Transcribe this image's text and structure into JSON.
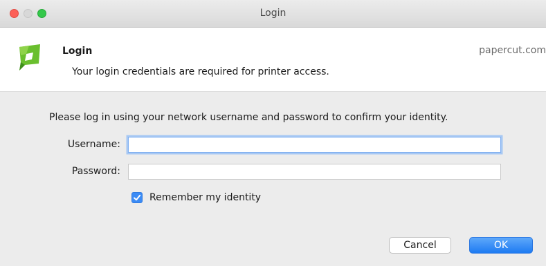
{
  "window": {
    "title": "Login"
  },
  "banner": {
    "title": "Login",
    "subtitle": "Your login credentials are required for printer access.",
    "brand": "papercut.com",
    "logo_icon": "papercut-logo-icon"
  },
  "form": {
    "instruction": "Please log in using your network username and password to confirm your identity.",
    "username_label": "Username:",
    "username_value": "",
    "password_label": "Password:",
    "password_value": "",
    "remember_label": "Remember my identity",
    "remember_checked": true
  },
  "buttons": {
    "cancel_label": "Cancel",
    "ok_label": "OK"
  },
  "colors": {
    "accent": "#1e7bf2",
    "close": "#fc5f57",
    "maximize": "#34c84a",
    "logo_green": "#6abf2e"
  }
}
